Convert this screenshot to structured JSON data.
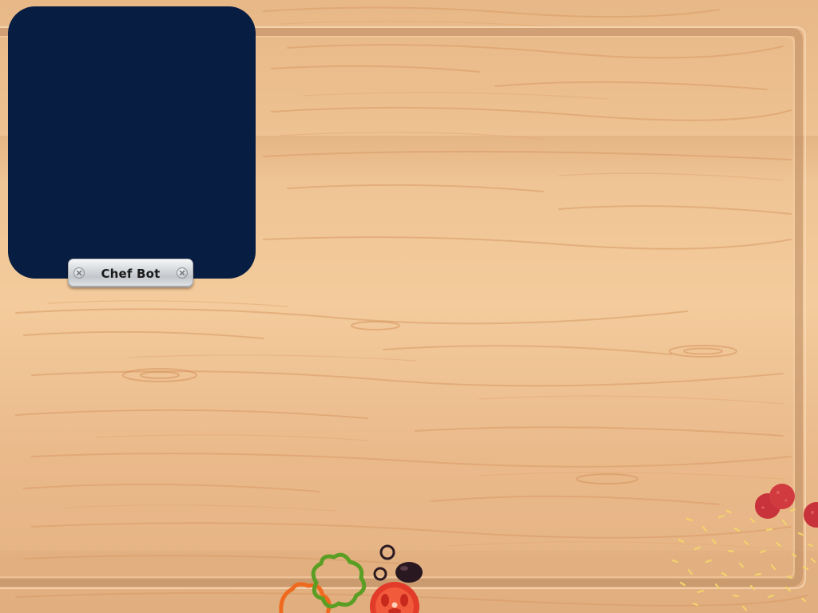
{
  "robot": {
    "name_label": "Chef Bot"
  },
  "theme": {
    "screen_color": "#071d42",
    "board_color": "#efc393",
    "board_edge_color": "#b98a62"
  },
  "toppings": [
    "green-pepper-icon",
    "orange-pepper-icon",
    "olive-ring-icon",
    "olive-icon",
    "tomato-slice-icon",
    "pepperoni-icon",
    "cheese-icon"
  ]
}
